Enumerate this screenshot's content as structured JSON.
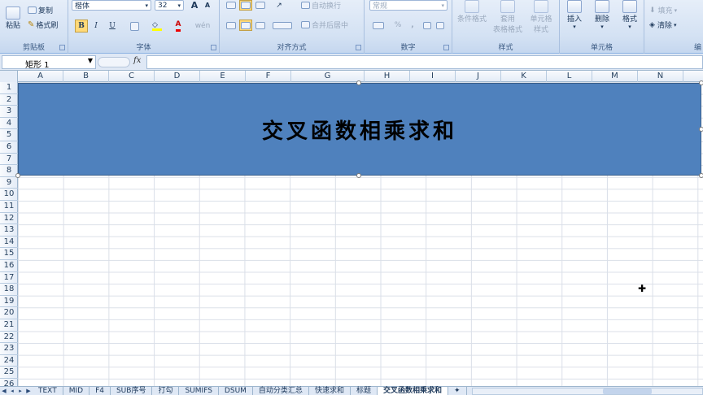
{
  "ribbon": {
    "clipboard": {
      "paste_label": "粘贴",
      "copy_label": "复制",
      "format_painter_label": "格式刷",
      "group_label": "剪贴板"
    },
    "font": {
      "font_name": "楷体",
      "font_size": "32",
      "bold": "B",
      "italic": "I",
      "underline": "U",
      "font_color_glyph": "A",
      "phonetic_label": "wén",
      "group_label": "字体",
      "grow_font": "A",
      "shrink_font": "A"
    },
    "alignment": {
      "wrap_text_label": "自动换行",
      "merge_center_label": "合并后居中",
      "group_label": "对齐方式"
    },
    "number": {
      "format_value": "常规",
      "percent": "%",
      "comma": ",",
      "group_label": "数字"
    },
    "styles": {
      "conditional_label": "条件格式",
      "table_label_1": "套用",
      "table_label_2": "表格格式",
      "cell_style_1": "单元格",
      "cell_style_2": "样式",
      "group_label": "样式"
    },
    "cells": {
      "insert_label": "插入",
      "delete_label": "删除",
      "format_label": "格式",
      "group_label": "单元格"
    },
    "editing": {
      "fill_label": "填充",
      "clear_label": "清除",
      "partial_label": "编"
    }
  },
  "formula_bar": {
    "name_box": "矩形 1",
    "fx_label": "fx",
    "formula_value": ""
  },
  "grid": {
    "columns": [
      "A",
      "B",
      "C",
      "D",
      "E",
      "F",
      "G",
      "H",
      "I",
      "J",
      "K",
      "L",
      "M",
      "N",
      "O"
    ],
    "rows": [
      "1",
      "2",
      "3",
      "4",
      "5",
      "6",
      "7",
      "8",
      "9",
      "10",
      "11",
      "12",
      "13",
      "14",
      "15",
      "16",
      "17",
      "18",
      "19",
      "20",
      "21",
      "22",
      "23",
      "24",
      "25",
      "26"
    ]
  },
  "shape": {
    "text": "交叉函数相乘求和",
    "fill_color": "#4f81bd"
  },
  "sheet_tabs": {
    "tabs": [
      "TEXT",
      "MID",
      "F4",
      "SUB序号",
      "打勾",
      "SUMIFS",
      "DSUM",
      "自动分类汇总",
      "快速求和",
      "标题",
      "交叉函数相乘求和"
    ],
    "active": "交叉函数相乘求和"
  }
}
